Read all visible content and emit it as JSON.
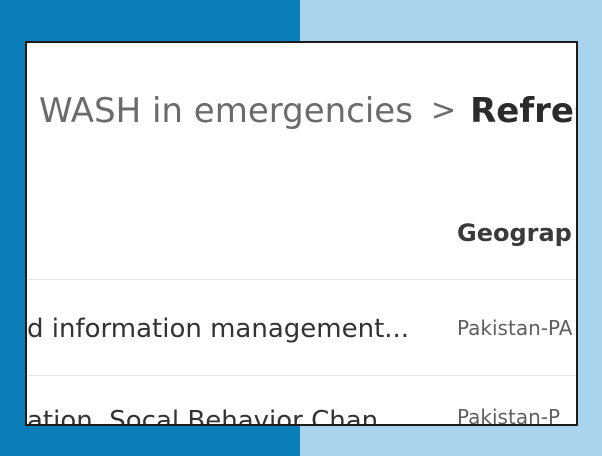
{
  "breadcrumb": {
    "parent": "WASH in emergencies",
    "separator": ">",
    "current": "Refres"
  },
  "table": {
    "columns": [
      "Geograp"
    ],
    "rows": [
      {
        "title": "d information management...",
        "geography": "Pakistan-PA"
      },
      {
        "title": "ation, Socal Behavior Chan",
        "geography": "Pakistan-P"
      }
    ]
  },
  "colors": {
    "frame_left": "#0b7db8",
    "frame_right": "#a9d4ee",
    "panel_border": "#1c1c1c"
  }
}
